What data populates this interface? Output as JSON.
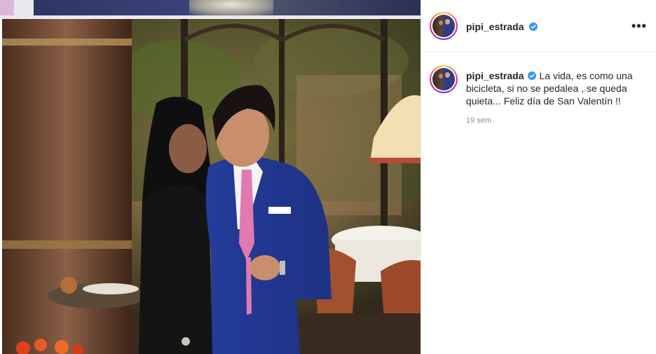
{
  "post": {
    "username": "pipi_estrada",
    "verified": true,
    "caption": "La vida, es como una bicicleta, si no se pedalea , se queda quieta... Feliz día de San Valentín !!",
    "timestamp": "19 sem"
  },
  "icons": {
    "verified": "verified-badge-icon",
    "more": "more-options-icon"
  },
  "colors": {
    "verified_blue": "#3897f0",
    "text": "#262626",
    "muted": "#8e8e8e"
  }
}
